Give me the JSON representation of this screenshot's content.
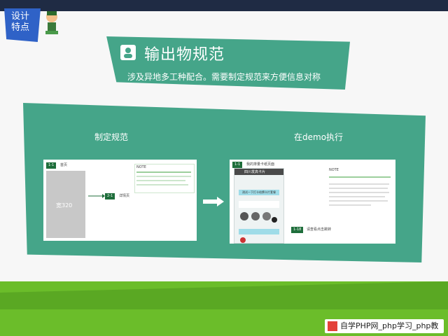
{
  "tag": {
    "line1": "设计",
    "line2": "特点"
  },
  "title": "输出物规范",
  "subtitle": "涉及异地多工种配合。需要制定规范来方便信息对称",
  "left": {
    "label": "制定规范",
    "box1": "1-1",
    "home": "首页",
    "placeholder": "宽320",
    "box2": "2-1",
    "detail": "详情页",
    "note_header": "NOTE"
  },
  "right": {
    "label": "在demo执行",
    "step_badge": "1-1",
    "top_title": "我的排量卡纸页面",
    "note_header": "NOTE",
    "phone_title": "四川发高卡片",
    "btn": "测试一下打卡给牌卡片套餐",
    "badge2": "1-18",
    "tip": "请查看点击跳转"
  },
  "watermark": "自学PHP网_php学习_php教"
}
